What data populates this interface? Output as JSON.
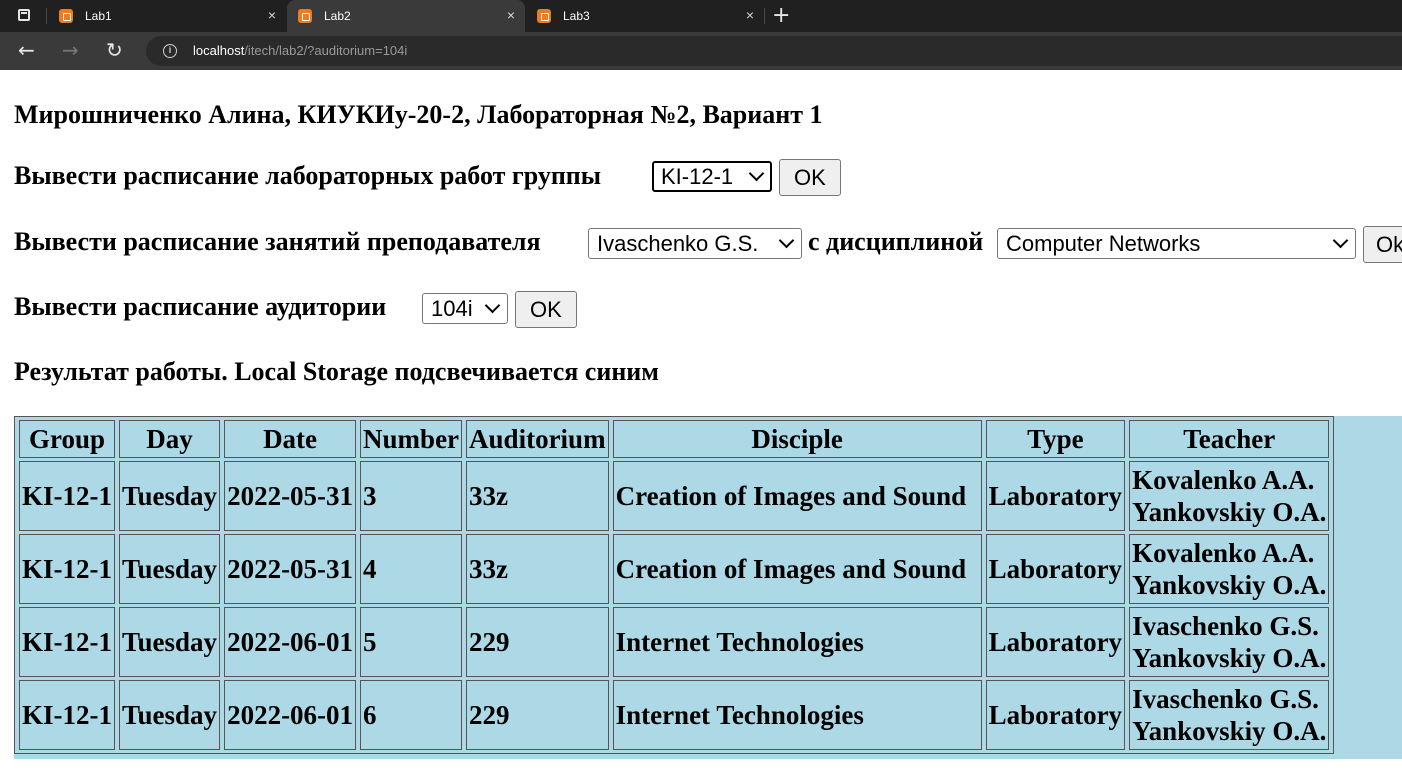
{
  "browser": {
    "tabs": [
      {
        "label": "Lab1",
        "active": false
      },
      {
        "label": "Lab2",
        "active": true
      },
      {
        "label": "Lab3",
        "active": false
      }
    ],
    "close_glyph": "×",
    "newtab_glyph": "+",
    "back_glyph": "←",
    "forward_glyph": "→",
    "reload_glyph": "↻",
    "info_glyph": "i",
    "url_host": "localhost",
    "url_path": "/itech/lab2/?auditorium=104i"
  },
  "page": {
    "title": "Мирошниченко Алина, КИУКИу-20-2, Лабораторная №2, Вариант 1",
    "group_label": "Вывести расписание лабораторных работ группы",
    "group_selected": "KI-12-1",
    "teacher_label": "Вывести расписание занятий преподавателя",
    "teacher_selected": "Ivaschenko G.S.",
    "discipline_label": "с дисциплиной",
    "discipline_selected": "Computer Networks",
    "auditorium_label": "Вывести расписание аудитории",
    "auditorium_selected": "104i",
    "ok_label": "OK",
    "ok_label_clipped": "Ok",
    "result_label": "Результат работы. Local Storage подсвечивается синим"
  },
  "table": {
    "columns": [
      "Group",
      "Day",
      "Date",
      "Number",
      "Auditorium",
      "Disciple",
      "Type",
      "Teacher"
    ],
    "rows": [
      {
        "group": "KI-12-1",
        "day": "Tuesday",
        "date": "2022-05-31",
        "number": "3",
        "auditorium": "33z",
        "disciple": "Creation of Images and Sound",
        "type": "Laboratory",
        "teacher1": "Kovalenko A.A.",
        "teacher2": "Yankovskiy O.A."
      },
      {
        "group": "KI-12-1",
        "day": "Tuesday",
        "date": "2022-05-31",
        "number": "4",
        "auditorium": "33z",
        "disciple": "Creation of Images and Sound",
        "type": "Laboratory",
        "teacher1": "Kovalenko A.A.",
        "teacher2": "Yankovskiy O.A."
      },
      {
        "group": "KI-12-1",
        "day": "Tuesday",
        "date": "2022-06-01",
        "number": "5",
        "auditorium": "229",
        "disciple": "Internet Technologies",
        "type": "Laboratory",
        "teacher1": "Ivaschenko G.S.",
        "teacher2": "Yankovskiy O.A."
      },
      {
        "group": "KI-12-1",
        "day": "Tuesday",
        "date": "2022-06-01",
        "number": "6",
        "auditorium": "229",
        "disciple": "Internet Technologies",
        "type": "Laboratory",
        "teacher1": "Ivaschenko G.S.",
        "teacher2": "Yankovskiy O.A."
      }
    ]
  },
  "colors": {
    "local_storage_highlight": "#add8e6",
    "tab_favicon": "#f07c22"
  }
}
